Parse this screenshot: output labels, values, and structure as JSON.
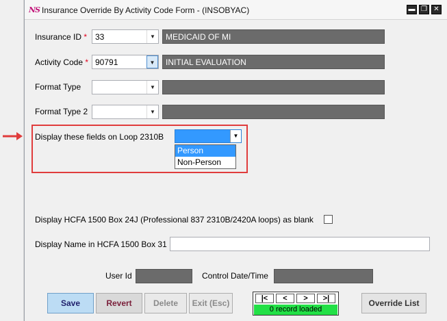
{
  "window": {
    "logo": "NS",
    "title": "Insurance Override By Activity Code Form - (INSOBYAC)",
    "controls": {
      "minimize": "▬",
      "restore": "❐",
      "close": "✕"
    }
  },
  "fields": {
    "insurance_id": {
      "label": "Insurance ID",
      "required_mark": "*",
      "value": "33",
      "description": "MEDICAID OF MI"
    },
    "activity_code": {
      "label": "Activity Code",
      "required_mark": "*",
      "value": "90791",
      "description": "INITIAL EVALUATION"
    },
    "format_type": {
      "label": "Format Type",
      "value": "",
      "description": ""
    },
    "format_type_2": {
      "label": "Format Type 2",
      "value": "",
      "description": ""
    },
    "loop_2310b": {
      "label": "Display these fields on Loop 2310B",
      "value": "",
      "options": [
        "Person",
        "Non-Person"
      ],
      "highlighted_option": "Person"
    },
    "hcfa_24j": {
      "label": "Display HCFA 1500 Box 24J (Professional 837 2310B/2420A loops) as blank",
      "checked": false
    },
    "hcfa_box31": {
      "label": "Display Name in HCFA 1500 Box 31",
      "value": ""
    },
    "user_id": {
      "label": "User Id",
      "value": ""
    },
    "control_date": {
      "label": "Control Date/Time",
      "value": ""
    }
  },
  "buttons": {
    "save": "Save",
    "revert": "Revert",
    "delete": "Delete",
    "exit": "Exit (Esc)",
    "override_list": "Override List"
  },
  "navigator": {
    "first": "|<",
    "prev": "<",
    "next": ">",
    "last": ">|",
    "status": "0 record loaded"
  },
  "colors": {
    "highlight_border": "#e03c3c",
    "selected_option": "#3399ff",
    "status_green": "#22e046",
    "readonly_field": "#6b6b6b"
  },
  "icons": {
    "dropdown": "chevron-down-icon",
    "pointer": "red-arrow-icon"
  }
}
